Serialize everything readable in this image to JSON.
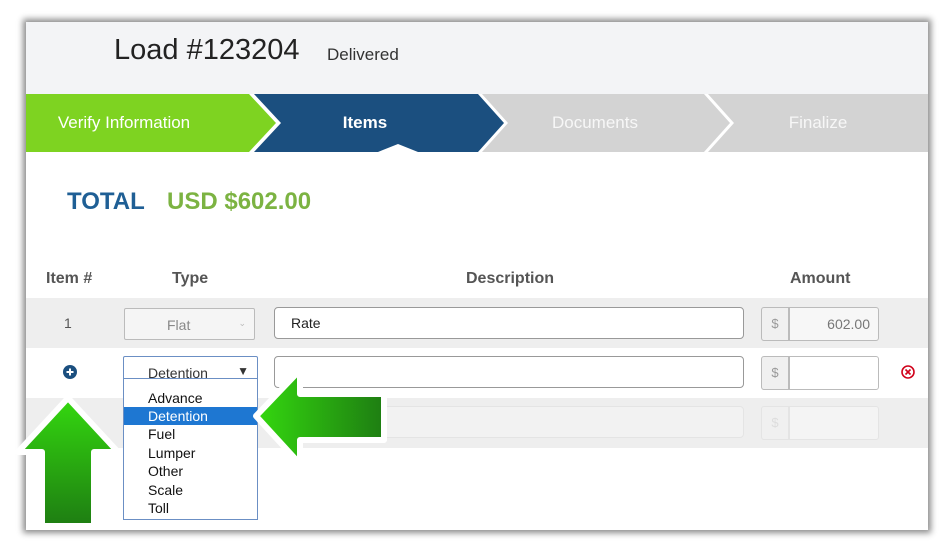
{
  "header": {
    "title": "Load #123204",
    "status": "Delivered"
  },
  "steps": [
    {
      "label": "Verify Information",
      "state": "done"
    },
    {
      "label": "Items",
      "state": "active"
    },
    {
      "label": "Documents",
      "state": "pending"
    },
    {
      "label": "Finalize",
      "state": "pending"
    }
  ],
  "total": {
    "label": "TOTAL",
    "value": "USD $602.00"
  },
  "columns": {
    "item": "Item #",
    "type": "Type",
    "description": "Description",
    "amount": "Amount"
  },
  "rows": [
    {
      "num": "1",
      "type": "Flat",
      "description": "Rate",
      "currency": "$",
      "amount": "602.00"
    },
    {
      "num": "",
      "type": "Detention",
      "description": "",
      "currency": "$",
      "amount": ""
    },
    {
      "currency": "$"
    }
  ],
  "dropdown": {
    "options": [
      "Advance",
      "Detention",
      "Fuel",
      "Lumper",
      "Other",
      "Scale",
      "Toll"
    ],
    "selected": "Detention"
  },
  "icons": {
    "add": "plus-circle-icon",
    "remove": "close-circle-icon",
    "select_caret": "caret-down-icon",
    "annotation": "green-arrow-icon"
  },
  "colors": {
    "step_done": "#7ed321",
    "step_active": "#1b4f7f",
    "step_pending": "#d3d3d3",
    "total_label": "#1f5f95",
    "total_value": "#7cb342",
    "remove": "#d0021b",
    "arrow": "#2bbf16"
  }
}
